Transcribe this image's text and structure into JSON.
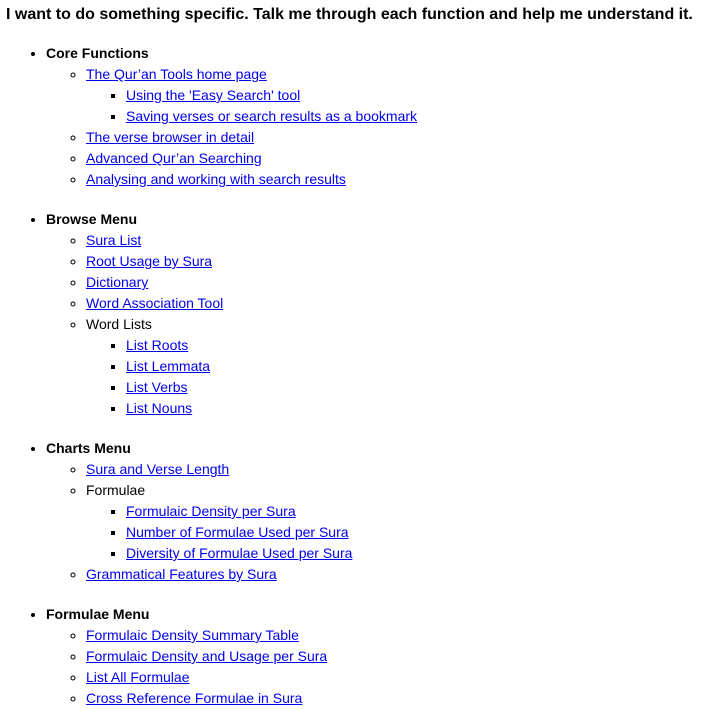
{
  "heading": "I want to do something specific. Talk me through each function and help me understand it.",
  "colors": {
    "link": "#0000ee",
    "text": "#000000",
    "background": "#ffffff"
  },
  "sections": [
    {
      "title": "Core Functions",
      "items": [
        {
          "label": "The Qur’an Tools home page",
          "link": true,
          "children": [
            {
              "label": "Using the 'Easy Search' tool",
              "link": true
            },
            {
              "label": "Saving verses or search results as a bookmark",
              "link": true
            }
          ]
        },
        {
          "label": "The verse browser in detail",
          "link": true
        },
        {
          "label": "Advanced Qur’an Searching",
          "link": true
        },
        {
          "label": "Analysing and working with search results",
          "link": true
        }
      ]
    },
    {
      "title": "Browse Menu",
      "items": [
        {
          "label": "Sura List",
          "link": true
        },
        {
          "label": "Root Usage by Sura",
          "link": true
        },
        {
          "label": "Dictionary",
          "link": true
        },
        {
          "label": "Word Association Tool",
          "link": true
        },
        {
          "label": "Word Lists",
          "link": false,
          "children": [
            {
              "label": "List Roots",
              "link": true
            },
            {
              "label": "List Lemmata",
              "link": true
            },
            {
              "label": "List Verbs",
              "link": true
            },
            {
              "label": "List Nouns",
              "link": true
            }
          ]
        }
      ]
    },
    {
      "title": "Charts Menu",
      "items": [
        {
          "label": "Sura and Verse Length",
          "link": true
        },
        {
          "label": "Formulae",
          "link": false,
          "children": [
            {
              "label": "Formulaic Density per Sura",
              "link": true
            },
            {
              "label": "Number of Formulae Used per Sura",
              "link": true
            },
            {
              "label": "Diversity of Formulae Used per Sura",
              "link": true
            }
          ]
        },
        {
          "label": "Grammatical Features by Sura",
          "link": true
        }
      ]
    },
    {
      "title": "Formulae Menu",
      "items": [
        {
          "label": "Formulaic Density Summary Table",
          "link": true
        },
        {
          "label": "Formulaic Density and Usage per Sura",
          "link": true
        },
        {
          "label": "List All Formulae",
          "link": true
        },
        {
          "label": "Cross Reference Formulae in Sura",
          "link": true
        }
      ]
    }
  ]
}
